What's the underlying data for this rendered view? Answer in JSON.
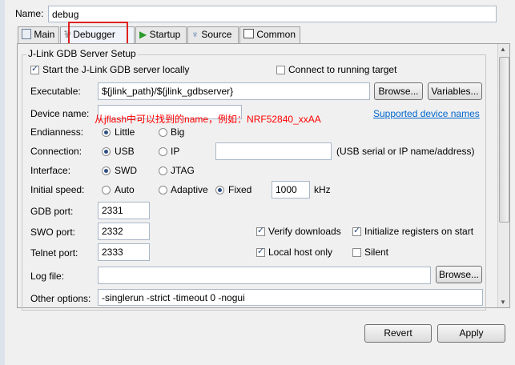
{
  "name_label": "Name:",
  "name_value": "debug",
  "tabs": [
    {
      "label": "Main"
    },
    {
      "label": "Debugger"
    },
    {
      "label": "Startup"
    },
    {
      "label": "Source"
    },
    {
      "label": "Common"
    }
  ],
  "group_title": "J-Link GDB Server Setup",
  "start_server_label": "Start the J-Link GDB server locally",
  "connect_running_label": "Connect to running target",
  "executable_label": "Executable:",
  "executable_value": "${jlink_path}/${jlink_gdbserver}",
  "browse_label": "Browse...",
  "variables_label": "Variables...",
  "device_name_label": "Device name:",
  "device_name_value": "",
  "device_annotation": "从jflash中可以找到的name，例如：NRF52840_xxAA",
  "supported_devices_link": "Supported device names",
  "endianness_label": "Endianness:",
  "little_label": "Little",
  "big_label": "Big",
  "connection_label": "Connection:",
  "usb_label": "USB",
  "ip_label": "IP",
  "ip_value": "",
  "usb_hint": "(USB serial or IP name/address)",
  "interface_label": "Interface:",
  "swd_label": "SWD",
  "jtag_label": "JTAG",
  "speed_label": "Initial speed:",
  "auto_label": "Auto",
  "adaptive_label": "Adaptive",
  "fixed_label": "Fixed",
  "speed_value": "1000",
  "khz_label": "kHz",
  "gdb_port_label": "GDB port:",
  "gdb_port_value": "2331",
  "swo_port_label": "SWO port:",
  "swo_port_value": "2332",
  "verify_label": "Verify downloads",
  "init_regs_label": "Initialize registers on start",
  "telnet_port_label": "Telnet port:",
  "telnet_port_value": "2333",
  "local_host_label": "Local host only",
  "silent_label": "Silent",
  "log_file_label": "Log file:",
  "log_file_value": "",
  "log_browse_label": "Browse...",
  "other_options_label": "Other options:",
  "other_options_value": "-singlerun -strict -timeout 0 -nogui",
  "revert_label": "Revert",
  "apply_label": "Apply",
  "colors": {
    "link": "#0066cc",
    "annotation": "#ff0000",
    "highlight_box": "#e02020"
  }
}
